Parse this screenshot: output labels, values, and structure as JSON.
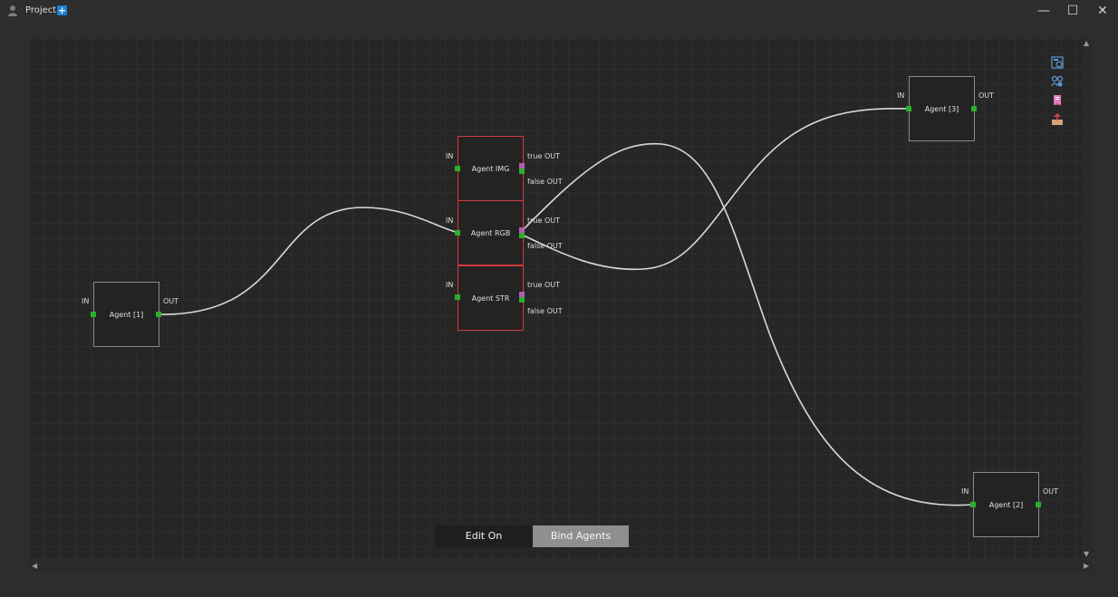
{
  "window": {
    "title": "Project",
    "add_icon": "plus-icon",
    "controls": {
      "minimize": "—",
      "maximize": "☐",
      "close": "✕"
    }
  },
  "nodes": [
    {
      "id": "agent1",
      "label": "Agent [1]",
      "in_label": "IN",
      "out_label": "OUT"
    },
    {
      "id": "agent_img",
      "label": "Agent IMG",
      "in_label": "IN",
      "true_label": "true OUT",
      "false_label": "false OUT"
    },
    {
      "id": "agent_rgb",
      "label": "Agent RGB",
      "in_label": "IN",
      "true_label": "true OUT",
      "false_label": "false OUT"
    },
    {
      "id": "agent_str",
      "label": "Agent STR",
      "in_label": "IN",
      "true_label": "true OUT",
      "false_label": "false OUT"
    },
    {
      "id": "agent3",
      "label": "Agent [3]",
      "in_label": "IN",
      "out_label": "OUT"
    },
    {
      "id": "agent2",
      "label": "Agent [2]",
      "in_label": "IN",
      "out_label": "OUT"
    }
  ],
  "toolbar_icons": [
    "fit-view-icon",
    "link-agents-icon",
    "bookmark-icon",
    "export-icon"
  ],
  "tabs": {
    "edit": "Edit On",
    "bind": "Bind Agents"
  },
  "colors": {
    "port": "#2bb02b",
    "port_alt": "#b65ab4",
    "selected_border": "#d43b3b",
    "wire": "#d9d9d9"
  }
}
